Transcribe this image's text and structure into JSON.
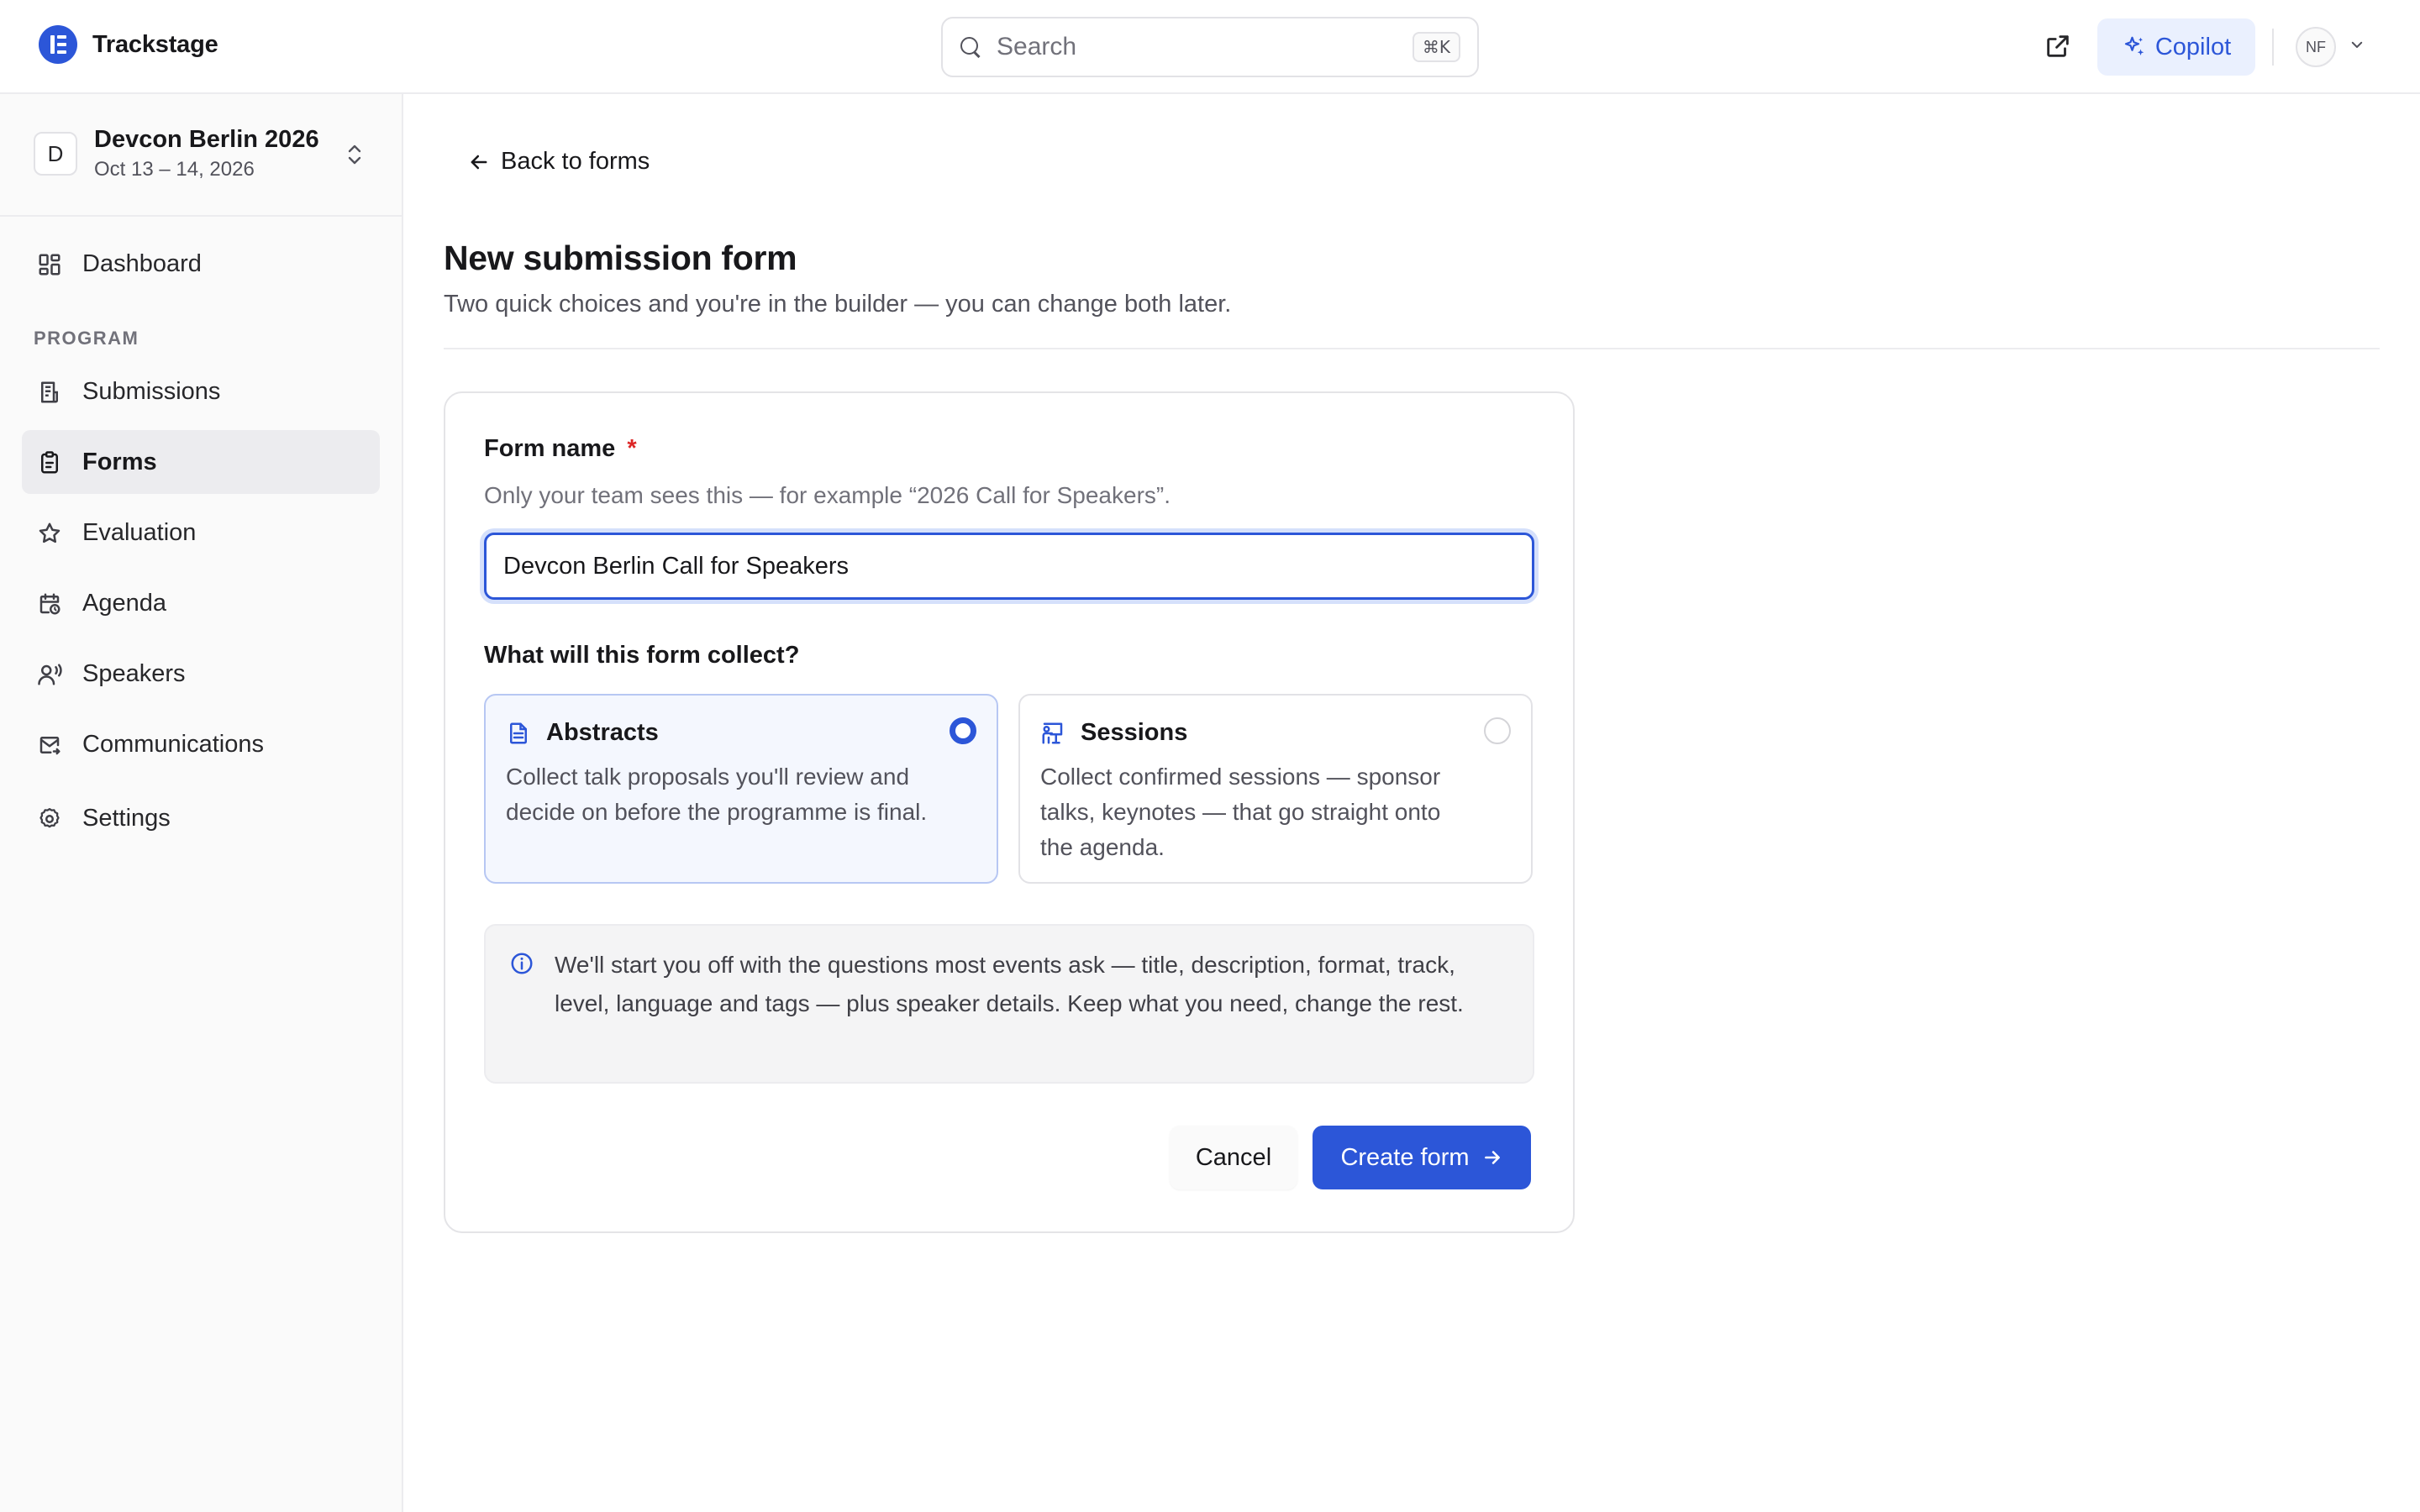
{
  "app": {
    "name": "Trackstage",
    "accent": "#2c56d8"
  },
  "header": {
    "search_placeholder": "Search",
    "search_shortcut": "⌘K",
    "copilot_label": "Copilot",
    "user_initials": "NF"
  },
  "event": {
    "badge": "D",
    "name": "Devcon Berlin 2026",
    "dates": "Oct 13 – 14, 2026"
  },
  "sidebar": {
    "top_item": {
      "label": "Dashboard",
      "icon": "dashboard-icon"
    },
    "section_label": "PROGRAM",
    "items": [
      {
        "label": "Submissions",
        "icon": "submissions-icon",
        "active": false
      },
      {
        "label": "Forms",
        "icon": "clipboard-icon",
        "active": true
      },
      {
        "label": "Evaluation",
        "icon": "star-icon",
        "active": false
      },
      {
        "label": "Agenda",
        "icon": "calendar-clock-icon",
        "active": false
      },
      {
        "label": "Speakers",
        "icon": "speaker-icon",
        "active": false
      },
      {
        "label": "Communications",
        "icon": "mail-icon",
        "active": false
      },
      {
        "label": "Settings",
        "icon": "gear-icon",
        "active": false
      }
    ]
  },
  "main": {
    "back_label": "Back to forms",
    "title": "New submission form",
    "subtitle": "Two quick choices and you're in the builder — you can change both later.",
    "form": {
      "name_label": "Form name",
      "required_mark": "*",
      "name_help": "Only your team sees this — for example “2026 Call for Speakers”.",
      "name_value": "Devcon Berlin Call for Speakers",
      "collect_label": "What will this form collect?",
      "options": [
        {
          "title": "Abstracts",
          "description": "Collect talk proposals you'll review and decide on before the programme is final.",
          "selected": true,
          "icon": "document-icon"
        },
        {
          "title": "Sessions",
          "description": "Collect confirmed sessions — sponsor talks, keynotes — that go straight onto the agenda.",
          "selected": false,
          "icon": "presenter-icon"
        }
      ],
      "info_text": "We'll start you off with the questions most events ask — title, description, format, track, level, language and tags — plus speaker details. Keep what you need, change the rest.",
      "cancel_label": "Cancel",
      "create_label": "Create form"
    }
  }
}
